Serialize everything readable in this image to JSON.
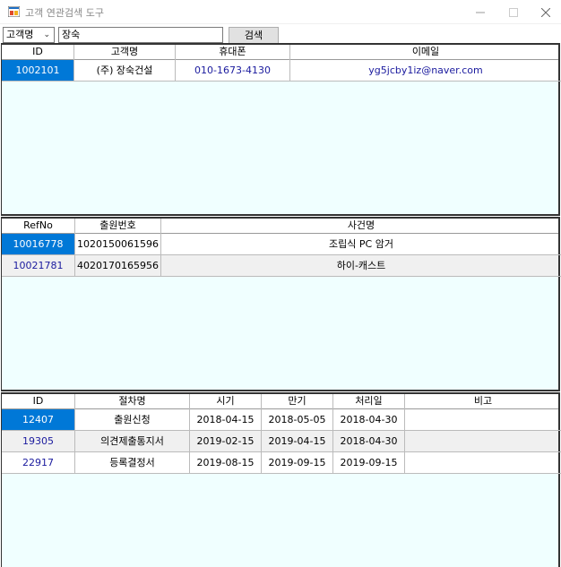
{
  "window": {
    "title": "고객 연관검색 도구"
  },
  "toolbar": {
    "field_select": "고객명",
    "search_value": "장숙",
    "search_button": "검색"
  },
  "customers": {
    "columns": [
      "ID",
      "고객명",
      "휴대폰",
      "이메일"
    ],
    "rows": [
      {
        "id": "1002101",
        "name": "(주) 장숙건설",
        "phone": "010-1673-4130",
        "email": "yg5jcby1iz@naver.com"
      }
    ]
  },
  "cases": {
    "columns": [
      "RefNo",
      "출원번호",
      "사건명"
    ],
    "rows": [
      {
        "refno": "10016778",
        "appno": "1020150061596",
        "title": "조립식 PC 암거"
      },
      {
        "refno": "10021781",
        "appno": "4020170165956",
        "title": "하이-캐스트"
      }
    ]
  },
  "procedures": {
    "columns": [
      "ID",
      "절차명",
      "시기",
      "만기",
      "처리일",
      "비고"
    ],
    "rows": [
      {
        "id": "12407",
        "name": "출원신청",
        "start": "2018-04-15",
        "due": "2018-05-05",
        "done": "2018-04-30",
        "note": ""
      },
      {
        "id": "19305",
        "name": "의견제출통지서",
        "start": "2019-02-15",
        "due": "2019-04-15",
        "done": "2018-04-30",
        "note": ""
      },
      {
        "id": "22917",
        "name": "등록결정서",
        "start": "2019-08-15",
        "due": "2019-09-15",
        "done": "2019-09-15",
        "note": ""
      }
    ]
  }
}
